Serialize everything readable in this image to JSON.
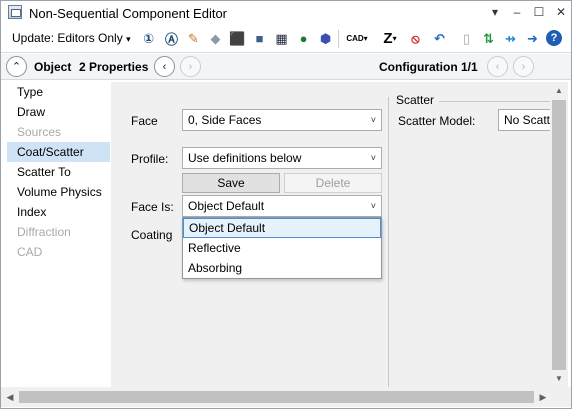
{
  "window": {
    "title": "Non-Sequential Component Editor",
    "controls": {
      "minimize": "▾",
      "restore": "–",
      "maximize": "☐",
      "close": "✕"
    }
  },
  "toolbar": {
    "update_label": "Update: Editors Only",
    "update_caret": "▾",
    "icons": [
      {
        "name": "ray-trace-icon",
        "glyph": "①"
      },
      {
        "name": "analysis-icon",
        "glyph": "Ⓐ"
      },
      {
        "name": "layout-icon",
        "glyph": "✎"
      },
      {
        "name": "shaded-model-icon",
        "glyph": "◆"
      },
      {
        "name": "solid-model-icon",
        "glyph": "⬛"
      },
      {
        "name": "cube-icon",
        "glyph": "■"
      },
      {
        "name": "grid-icon",
        "glyph": "▦"
      },
      {
        "name": "lens-icon",
        "glyph": "●"
      },
      {
        "name": "hexagon-icon",
        "glyph": "⬢"
      }
    ],
    "cad_label": "CAD",
    "cad_caret": "▾",
    "z_label": "Z",
    "z_caret": "▾",
    "right_icons": [
      {
        "name": "stop-icon",
        "glyph": "⦸"
      },
      {
        "name": "undo-arrow-icon",
        "glyph": "↶"
      },
      {
        "name": "blank-page-icon",
        "glyph": "▯"
      },
      {
        "name": "swap-icon",
        "glyph": "⇅"
      },
      {
        "name": "collapse-icon",
        "glyph": "⇸"
      },
      {
        "name": "arrow-right-icon",
        "glyph": "➜"
      },
      {
        "name": "help-icon",
        "glyph": "?"
      }
    ]
  },
  "nav": {
    "collapse_glyph": "⌃",
    "object_label": "Object",
    "properties_label": "2 Properties",
    "prev_glyph": "‹",
    "next_glyph": "›",
    "configuration_label": "Configuration 1/1"
  },
  "categories": [
    {
      "label": "Type",
      "state": "normal"
    },
    {
      "label": "Draw",
      "state": "normal"
    },
    {
      "label": "Sources",
      "state": "disabled"
    },
    {
      "label": "Coat/Scatter",
      "state": "selected"
    },
    {
      "label": "Scatter To",
      "state": "normal"
    },
    {
      "label": "Volume Physics",
      "state": "normal"
    },
    {
      "label": "Index",
      "state": "normal"
    },
    {
      "label": "Diffraction",
      "state": "disabled"
    },
    {
      "label": "CAD",
      "state": "disabled"
    }
  ],
  "form": {
    "face_label": "Face",
    "face_value": "0, Side Faces",
    "profile_label": "Profile:",
    "profile_value": "Use definitions below",
    "save_label": "Save",
    "delete_label": "Delete",
    "face_is_label": "Face Is:",
    "face_is_value": "Object Default",
    "coating_label": "Coating",
    "dropdown_caret": "˅"
  },
  "face_is_options": [
    "Object Default",
    "Reflective",
    "Absorbing"
  ],
  "scatter": {
    "group_title": "Scatter",
    "model_label": "Scatter Model:",
    "model_value": "No Scatt"
  },
  "scroll": {
    "up": "▲",
    "down": "▼",
    "left": "◀",
    "right": "▶"
  }
}
